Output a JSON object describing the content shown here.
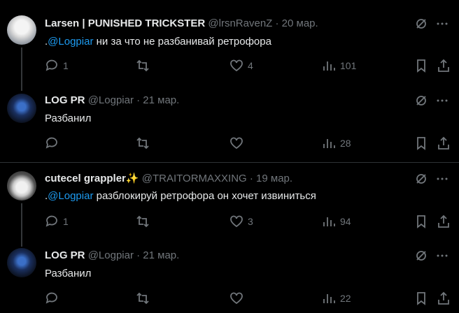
{
  "tweets": [
    {
      "name": "Larsen | PUNISHED TRICKSTER",
      "handle": "@lrsnRavenZ",
      "date": " · 20 мар.",
      "mention_prefix": ".",
      "mention": "@Logpiar",
      "text": " ни за что не разбанивай ретрофора",
      "replies": "1",
      "retweets": "",
      "likes": "4",
      "views": "101"
    },
    {
      "name": "LOG PR",
      "handle": "@Logpiar",
      "date": " · 21 мар.",
      "text": "Разбанил",
      "replies": "",
      "retweets": "",
      "likes": "",
      "views": "28"
    },
    {
      "name": "cutecel grappler✨",
      "handle": "@TRAITORMAXXING",
      "date": " · 19 мар.",
      "mention_prefix": ".",
      "mention": "@Logpiar",
      "text": " разблокируй ретрофора он хочет извиниться",
      "replies": "1",
      "retweets": "",
      "likes": "3",
      "views": "94"
    },
    {
      "name": "LOG PR",
      "handle": "@Logpiar",
      "date": " · 21 мар.",
      "text": "Разбанил",
      "replies": "",
      "retweets": "",
      "likes": "",
      "views": "22"
    }
  ],
  "colors": {
    "background": "#000000",
    "text": "#e7e9ea",
    "muted": "#71767b",
    "link": "#1d9bf0"
  },
  "icons": [
    "grok-icon",
    "more-icon",
    "reply-icon",
    "retweet-icon",
    "like-icon",
    "views-icon",
    "bookmark-icon",
    "share-icon"
  ]
}
